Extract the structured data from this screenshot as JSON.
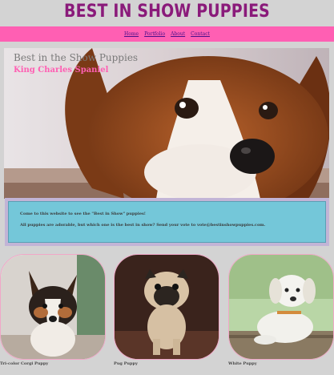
{
  "header": {
    "title": "BEST IN SHOW PUPPIES"
  },
  "nav": {
    "items": [
      "Home",
      "Portfolio",
      "About",
      "Contact"
    ]
  },
  "hero": {
    "heading": "Best in the Show Puppies",
    "subheading": "King Charles Spaniel"
  },
  "info": {
    "line1": "Come to this website to see the \"Best in Show\" puppies!",
    "line2": "All puppies are adorable, but which one is the best in show? Send your vote to vote@bestinshowpuppies.com."
  },
  "gallery": {
    "items": [
      {
        "caption": "Tri-color Corgi Puppy"
      },
      {
        "caption": "Pug Puppy"
      },
      {
        "caption": "White Puppy"
      }
    ]
  },
  "colors": {
    "title": "#8a1a7a",
    "navbar": "#ff5fb3",
    "accent_pink": "#ff5fb3",
    "info_bg": "#74c7d9",
    "info_border": "#c2b4d6",
    "page_bg": "#d3d3d3"
  }
}
